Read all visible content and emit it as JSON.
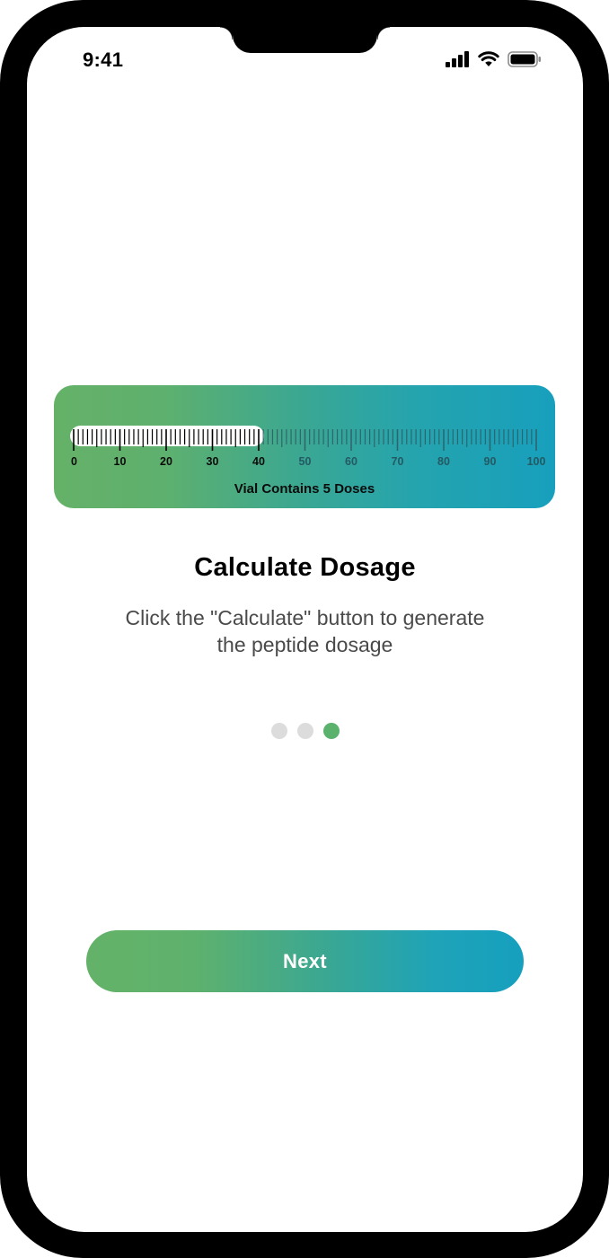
{
  "status_bar": {
    "time": "9:41",
    "icons": [
      "cellular-signal-icon",
      "wifi-icon",
      "battery-icon"
    ]
  },
  "dosage_ruler": {
    "tick_labels": [
      "0",
      "10",
      "20",
      "30",
      "40",
      "50",
      "60",
      "70",
      "80",
      "90",
      "100"
    ],
    "fill_value": 40,
    "max_value": 100,
    "caption": "Vial Contains 5 Doses",
    "colors": {
      "gradient_start": "#65b168",
      "gradient_end": "#179fbd",
      "fill": "#ffffff",
      "tick_active": "#000000",
      "tick_inactive": "#2f5f66"
    }
  },
  "onboarding": {
    "title": "Calculate Dosage",
    "description_line1": "Click the \"Calculate\" button to generate",
    "description_line2": "the peptide dosage",
    "page_count": 3,
    "active_page": 3
  },
  "actions": {
    "next_label": "Next"
  },
  "colors": {
    "accent_green": "#5bb26d",
    "accent_teal": "#16a0be",
    "dot_inactive": "#dcdcdc"
  }
}
